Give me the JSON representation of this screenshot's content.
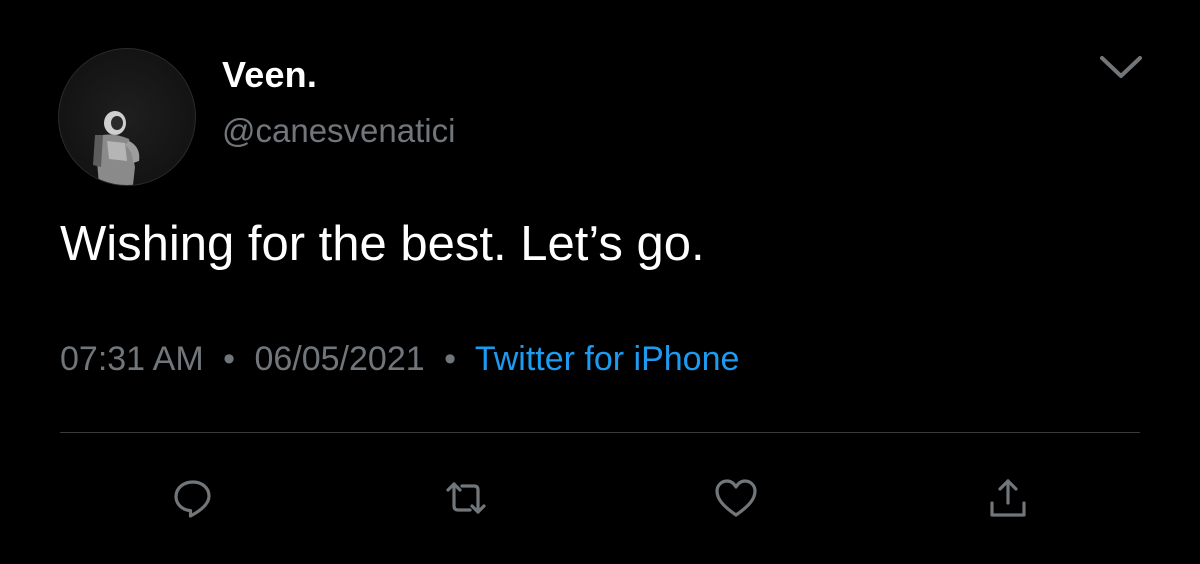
{
  "tweet": {
    "display_name": "Veen.",
    "handle": "@canesvenatici",
    "text": "Wishing for the best. Let’s go.",
    "time": "07:31 AM",
    "separator": "•",
    "date": "06/05/2021",
    "source": "Twitter for iPhone"
  },
  "actions": {
    "reply_icon": "reply-icon",
    "retweet_icon": "retweet-icon",
    "like_icon": "heart-icon",
    "share_icon": "share-icon"
  },
  "colors": {
    "background": "#000000",
    "primary_text": "#ffffff",
    "secondary_text": "#71767b",
    "link": "#1d9bf0",
    "icon": "#71767b"
  }
}
